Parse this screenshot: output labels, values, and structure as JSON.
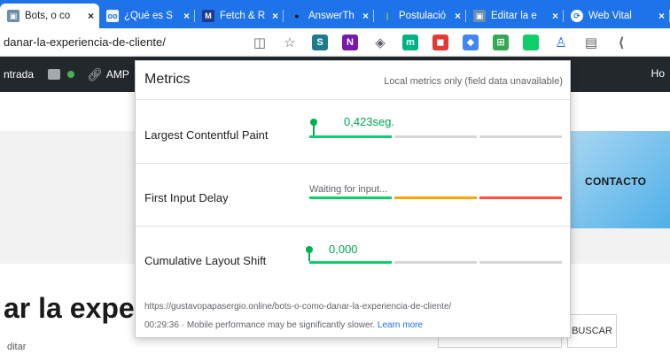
{
  "browser": {
    "tabs": [
      {
        "label": "Bots, o co",
        "active": true,
        "favicon_color": "#6b8fa8",
        "favicon_glyph": "▣"
      },
      {
        "label": "¿Qué es S",
        "active": false,
        "favicon_color": "#f3f3f3",
        "favicon_glyph": "oo"
      },
      {
        "label": "Fetch & R",
        "active": false,
        "favicon_color": "#1f3a93",
        "favicon_glyph": "M"
      },
      {
        "label": "AnswerTh",
        "active": false,
        "favicon_color": "#222222",
        "favicon_glyph": "●"
      },
      {
        "label": "Postulació",
        "active": false,
        "favicon_color": "#8fd14f",
        "favicon_glyph": "|"
      },
      {
        "label": "Editar la e",
        "active": false,
        "favicon_color": "#6b8fa8",
        "favicon_glyph": "▣"
      },
      {
        "label": "Web Vital",
        "active": false,
        "favicon_color": "#ffffff",
        "favicon_glyph": "⟳"
      }
    ],
    "close_glyph": "×",
    "url": "danar-la-experiencia-de-cliente/",
    "toolbar_icons": [
      {
        "name": "reader-mode-icon",
        "color": "#5f6368",
        "glyph": "◫"
      },
      {
        "name": "favorite-star-icon",
        "color": "#5f6368",
        "glyph": "☆"
      },
      {
        "name": "sway-icon",
        "color": "#1f7a8c",
        "glyph": "S"
      },
      {
        "name": "onenote-icon",
        "color": "#7719aa",
        "glyph": "N"
      },
      {
        "name": "extension-puzzle-icon",
        "color": "#5f6368",
        "glyph": "◈"
      },
      {
        "name": "extension-m-icon",
        "color": "#00b386",
        "glyph": "m"
      },
      {
        "name": "extension-red-icon",
        "color": "#e53935",
        "glyph": "◼"
      },
      {
        "name": "translate-icon",
        "color": "#4285f4",
        "glyph": "◆"
      },
      {
        "name": "translate-badge-icon",
        "color": "#34a853",
        "glyph": "⊞"
      },
      {
        "name": "web-vitals-icon",
        "color": "#0cce6b",
        "glyph": ""
      },
      {
        "name": "profile-icon",
        "color": "#1a73e8",
        "glyph": "♙"
      },
      {
        "name": "collections-icon",
        "color": "#5f6368",
        "glyph": "▤"
      },
      {
        "name": "more-icon",
        "color": "#5f6368",
        "glyph": "⟨"
      }
    ]
  },
  "adminbar": {
    "entry_label": "ntrada",
    "amp_label": "AMP",
    "right_label": "Ho"
  },
  "page": {
    "contact_label": "CONTACTO",
    "title": "ar la expe",
    "edit_label": "ditar",
    "search_button": "BUSCAR"
  },
  "popup": {
    "title": "Metrics",
    "note": "Local metrics only (field data unavailable)",
    "metrics": [
      {
        "name": "Largest Contentful Paint",
        "value": "0,423seg.",
        "status": "good",
        "marker": 0.05
      },
      {
        "name": "First Input Delay",
        "value": "Waiting for input...",
        "status": "waiting"
      },
      {
        "name": "Cumulative Layout Shift",
        "value": "0,000",
        "status": "good",
        "marker": 0.0
      }
    ],
    "url": "https://gustavopapasergio.online/bots-o-como-danar-la-experiencia-de-cliente/",
    "time": "00:29:36",
    "footer_text": " · Mobile performance may be significantly slower. ",
    "learn_more": "Learn more"
  },
  "colors": {
    "good": "#0cce6b",
    "needs_improvement": "#ffa400",
    "poor": "#ff4e42",
    "inactive": "#d6d6d6",
    "tab_strip": "#1e73e8",
    "adminbar": "#23282d"
  }
}
